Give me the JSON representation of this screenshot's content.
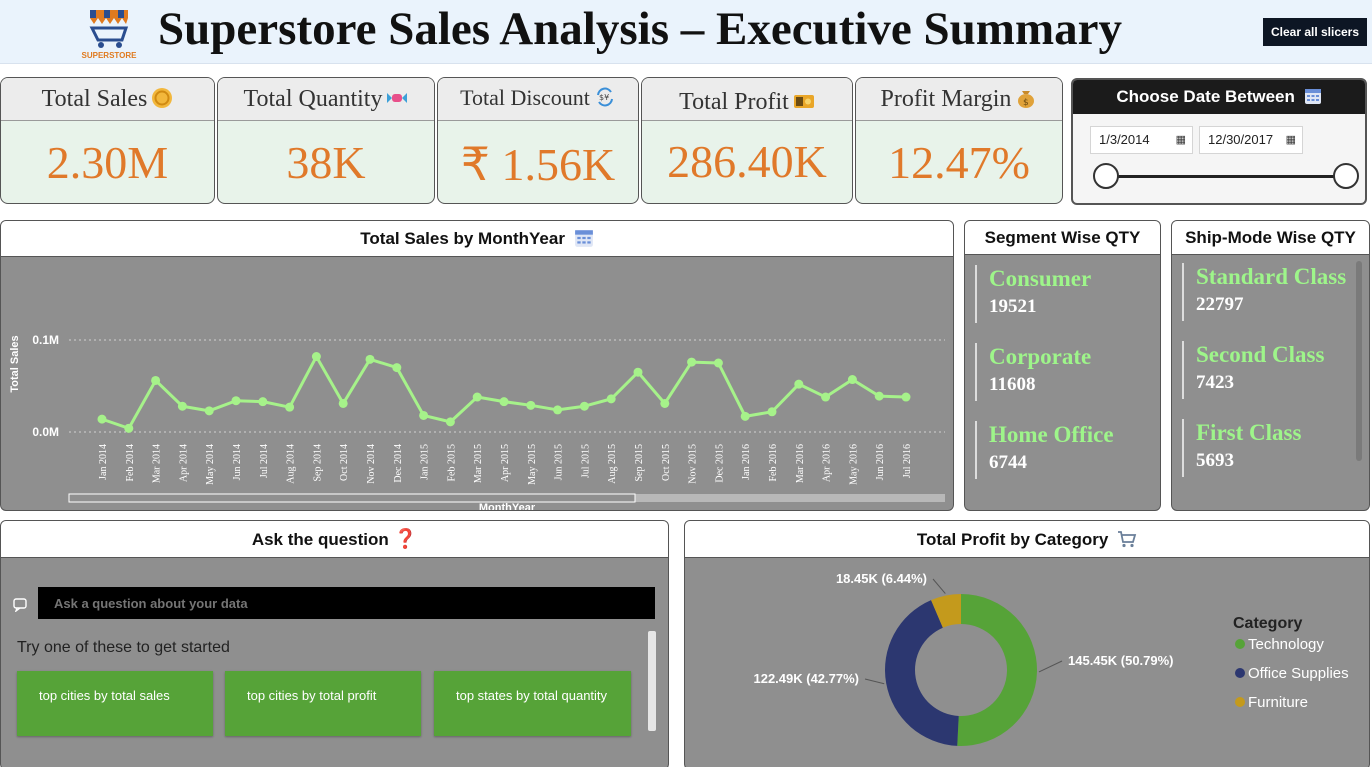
{
  "header": {
    "logo_text": "SUPERSTORE",
    "title": "Superstore Sales Analysis – Executive Summary",
    "clear_label": "Clear all slicers"
  },
  "kpis": [
    {
      "label": "Total Sales",
      "value": "2.30M",
      "icon": "coin-icon"
    },
    {
      "label": "Total Quantity",
      "value": "38K",
      "icon": "candy-icon"
    },
    {
      "label": "Total Discount",
      "value": "₹ 1.56K",
      "icon": "currency-exchange-icon"
    },
    {
      "label": "Total Profit",
      "value": "286.40K",
      "icon": "money-icon"
    },
    {
      "label": "Profit Margin",
      "value": "12.47%",
      "icon": "money-bag-icon"
    }
  ],
  "date_slicer": {
    "title": "Choose Date Between",
    "start": "1/3/2014",
    "end": "12/30/2017"
  },
  "sales_chart": {
    "title": "Total Sales by MonthYear"
  },
  "segment": {
    "title": "Segment Wise QTY",
    "items": [
      {
        "name": "Consumer",
        "value": "19521"
      },
      {
        "name": "Corporate",
        "value": "11608"
      },
      {
        "name": "Home Office",
        "value": "6744"
      }
    ]
  },
  "shipmode": {
    "title": "Ship-Mode Wise QTY",
    "items": [
      {
        "name": "Standard Class",
        "value": "22797"
      },
      {
        "name": "Second Class",
        "value": "7423"
      },
      {
        "name": "First Class",
        "value": "5693"
      }
    ]
  },
  "qa": {
    "title": "Ask the question",
    "placeholder": "Ask a question about your data",
    "hint": "Try one of these to get started",
    "suggestions": [
      "top cities by total sales",
      "top cities by total profit",
      "top states by total quantity"
    ]
  },
  "profit_chart": {
    "title": "Total Profit by Category"
  },
  "chart_data": [
    {
      "type": "line",
      "ylabel": "Total Sales",
      "xlabel": "MonthYear",
      "ytick_labels": [
        "0.0M",
        "0.1M"
      ],
      "ylim": [
        0,
        0.1
      ],
      "x": [
        "Jan 2014",
        "Feb 2014",
        "Mar 2014",
        "Apr 2014",
        "May 2014",
        "Jun 2014",
        "Jul 2014",
        "Aug 2014",
        "Sep 2014",
        "Oct 2014",
        "Nov 2014",
        "Dec 2014",
        "Jan 2015",
        "Feb 2015",
        "Mar 2015",
        "Apr 2015",
        "May 2015",
        "Jun 2015",
        "Jul 2015",
        "Aug 2015",
        "Sep 2015",
        "Oct 2015",
        "Nov 2015",
        "Dec 2015",
        "Jan 2016",
        "Feb 2016",
        "Mar 2016",
        "Apr 2016",
        "May 2016",
        "Jun 2016",
        "Jul 2016"
      ],
      "values": [
        0.014,
        0.004,
        0.056,
        0.028,
        0.023,
        0.034,
        0.033,
        0.027,
        0.082,
        0.031,
        0.079,
        0.07,
        0.018,
        0.011,
        0.038,
        0.033,
        0.029,
        0.024,
        0.028,
        0.036,
        0.065,
        0.031,
        0.076,
        0.075,
        0.017,
        0.022,
        0.052,
        0.038,
        0.057,
        0.039,
        0.038
      ],
      "grid": true,
      "color": "#a6f28a"
    },
    {
      "type": "pie",
      "legend_title": "Category",
      "legend": "right",
      "categories": [
        "Technology",
        "Office Supplies",
        "Furniture"
      ],
      "values": [
        145.45,
        122.49,
        18.45
      ],
      "labels": [
        "145.45K (50.79%)",
        "122.49K (42.77%)",
        "18.45K (6.44%)"
      ],
      "colors": [
        "#56a338",
        "#2c3770",
        "#c49a1c"
      ]
    }
  ]
}
